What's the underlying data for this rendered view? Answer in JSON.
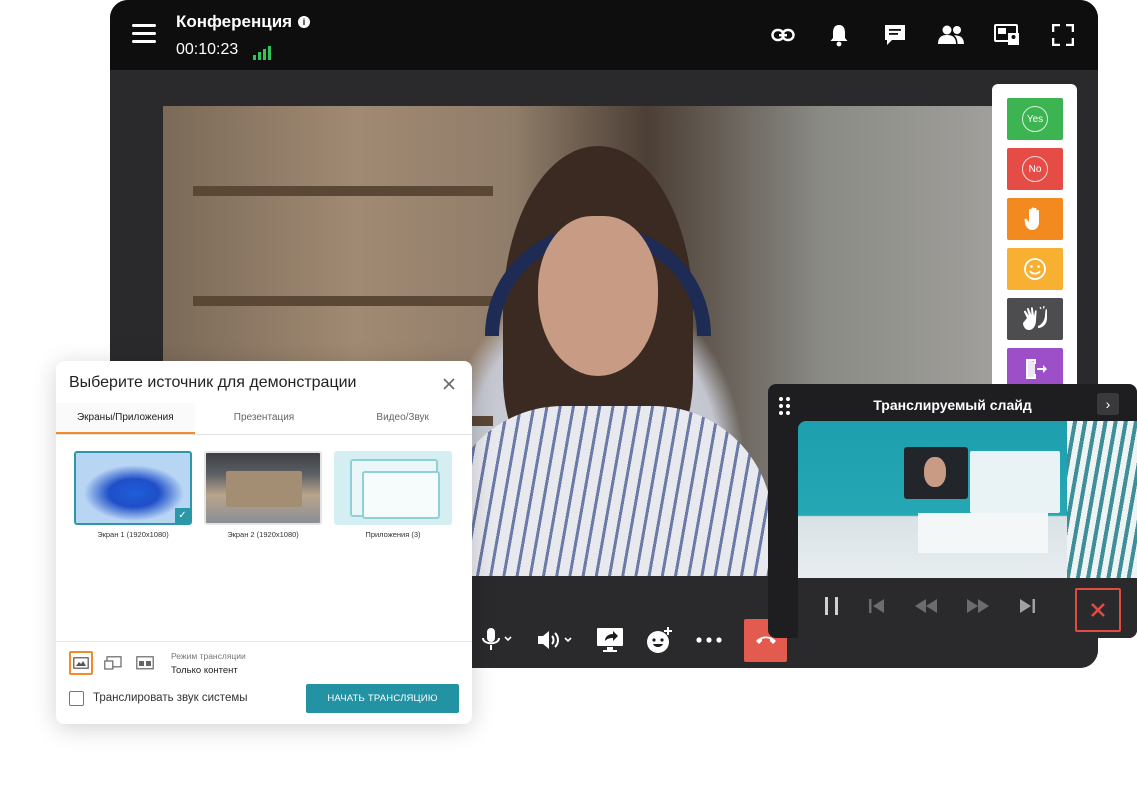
{
  "header": {
    "title": "Конференция",
    "timer": "00:10:23"
  },
  "top_icons": [
    "link-icon",
    "bell-icon",
    "chat-icon",
    "participants-icon",
    "layout-icon",
    "fullscreen-icon"
  ],
  "reactions": [
    {
      "name": "yes",
      "label": "Yes",
      "color": "#3cb451"
    },
    {
      "name": "no",
      "label": "No",
      "color": "#e44c45"
    },
    {
      "name": "raise-hand",
      "label": "",
      "color": "#f38a1f"
    },
    {
      "name": "smile",
      "label": "",
      "color": "#f7b031"
    },
    {
      "name": "clap",
      "label": "",
      "color": "#4d4d4f"
    },
    {
      "name": "leave",
      "label": "",
      "color": "#9c4fc7"
    }
  ],
  "slide_panel": {
    "title": "Транслируемый слайд"
  },
  "dialog": {
    "title": "Выберите источник для демонстрации",
    "tabs": [
      {
        "label": "Экраны/Приложения",
        "active": true
      },
      {
        "label": "Презентация",
        "active": false
      },
      {
        "label": "Видео/Звук",
        "active": false
      }
    ],
    "sources": [
      {
        "caption": "Экран 1 (1920x1080)",
        "selected": true
      },
      {
        "caption": "Экран 2 (1920x1080)",
        "selected": false
      },
      {
        "caption": "Приложения (3)",
        "selected": false
      }
    ],
    "mode_label": "Режим трансляции",
    "mode_value": "Только контент",
    "sound_label": "Транслировать звук системы",
    "sound_checked": false,
    "start_button": "НАЧАТЬ ТРАНСЛЯЦИЮ"
  },
  "colors": {
    "accent": "#2393a3",
    "tab_active": "#f38a2c",
    "hangup": "#e35a4f",
    "signal": "#2fc45a"
  }
}
